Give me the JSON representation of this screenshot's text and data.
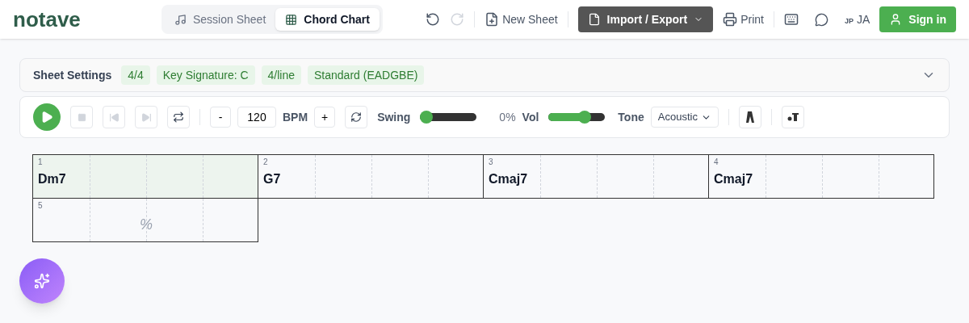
{
  "logo": "notave",
  "modes": [
    {
      "label": "Session Sheet",
      "selected": false,
      "kind": "music"
    },
    {
      "label": "Chord Chart",
      "selected": true,
      "kind": "grid"
    }
  ],
  "toolbar": {
    "undo_disabled": false,
    "redo_disabled": true,
    "new_sheet": "New Sheet",
    "import_export": "Import / Export",
    "print": "Print",
    "lang_code": "JP",
    "lang": "JA",
    "sign_in": "Sign in"
  },
  "settings": {
    "title": "Sheet Settings",
    "tags": [
      "4/4",
      "Key Signature: C",
      "4/line",
      "Standard (EADGBE)"
    ],
    "expanded": false
  },
  "player": {
    "bpm": "120",
    "bpm_label": "BPM",
    "minus": "-",
    "plus": "+",
    "swing_label": "Swing",
    "swing": {
      "level": 0
    },
    "swing_reading": "0%",
    "vol_label": "Vol",
    "vol": {
      "level": 0.67
    },
    "tone_label": "Tone",
    "tone": "Acoustic"
  },
  "measures": [
    {
      "number": "1",
      "kind": "chord",
      "chord": "Dm7",
      "selected": true
    },
    {
      "number": "2",
      "kind": "chord",
      "chord": "G7",
      "selected": false
    },
    {
      "number": "3",
      "kind": "chord",
      "chord": "Cmaj7",
      "selected": false
    },
    {
      "number": "4",
      "kind": "chord",
      "chord": "Cmaj7",
      "selected": false
    },
    {
      "number": "5",
      "kind": "repeat",
      "chord": "%",
      "selected": false
    }
  ]
}
